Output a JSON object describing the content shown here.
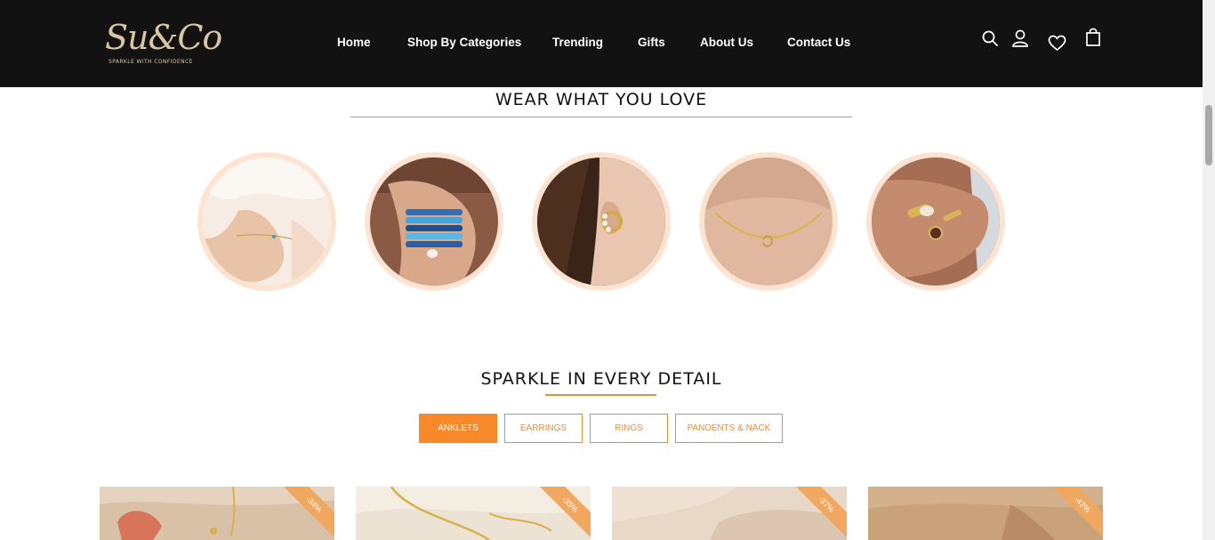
{
  "brand": {
    "logo_text": "Su&Co",
    "tagline": "SPARKLE WITH CONFIDENCE"
  },
  "nav": {
    "items": [
      {
        "label": "Home"
      },
      {
        "label": "Shop By Categories"
      },
      {
        "label": "Trending"
      },
      {
        "label": "Gifts"
      },
      {
        "label": "About Us"
      },
      {
        "label": "Contact Us"
      }
    ]
  },
  "header_icons": [
    "search-icon",
    "account-icon",
    "wishlist-heart-icon",
    "cart-bag-icon"
  ],
  "section1": {
    "title": "WEAR WHAT YOU LOVE",
    "categories": [
      "anklets",
      "bracelets",
      "earrings",
      "necklaces",
      "rings"
    ]
  },
  "section2": {
    "title": "SPARKLE IN EVERY DETAIL",
    "tabs": [
      {
        "label": "ANKLETS",
        "active": true
      },
      {
        "label": "EARRINGS",
        "active": false
      },
      {
        "label": "RINGS",
        "active": false
      },
      {
        "label": "PANDENTS & NACK",
        "active": false
      }
    ]
  },
  "products": [
    {
      "discount": "-34%"
    },
    {
      "discount": "-35%"
    },
    {
      "discount": "-37%"
    },
    {
      "discount": "-43%"
    }
  ],
  "colors": {
    "header_bg": "#121212",
    "accent": "#f08a2c",
    "circle_ring": "#fde4d2",
    "badge": "#f0a860"
  }
}
